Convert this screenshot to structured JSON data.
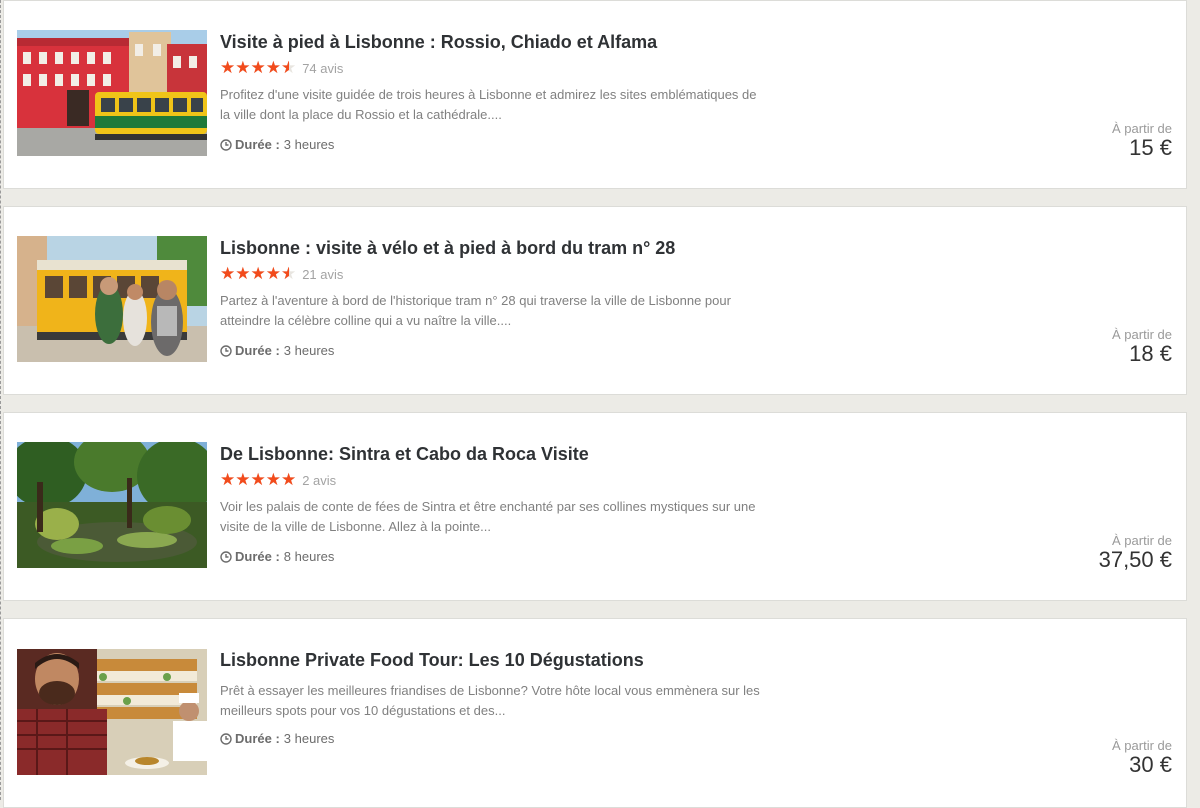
{
  "colors": {
    "star": "#f24b1c",
    "title": "#2f3235",
    "page_background": "#ecebe6"
  },
  "tours": [
    {
      "title": "Visite à pied à Lisbonne : Rossio, Chiado et Alfama",
      "rating": 4.5,
      "reviews": "74 avis",
      "description": "Profitez d'une visite guidée de trois heures à Lisbonne et admirez les sites emblématiques de la ville dont la place du Rossio et la cathédrale....",
      "duration_label": "Durée :",
      "duration_value": "3 heures",
      "price_from": "À partir de",
      "price": "15 €",
      "image": "lisbon-square-tram-photo"
    },
    {
      "title": "Lisbonne : visite à vélo et à pied à bord du tram n° 28",
      "rating": 4.5,
      "reviews": "21 avis",
      "description": "Partez à l'aventure à bord de l'historique tram n° 28 qui traverse la ville de Lisbonne pour atteindre la célèbre colline qui a vu naître la ville....",
      "duration_label": "Durée :",
      "duration_value": "3 heures",
      "price_from": "À partir de",
      "price": "18 €",
      "image": "tram-28-boarding-photo"
    },
    {
      "title": "De Lisbonne: Sintra et Cabo da Roca Visite",
      "rating": 5,
      "reviews": "2 avis",
      "description": "Voir les palais de conte de fées de Sintra et être enchanté par ses collines mystiques sur une visite de la ville de Lisbonne. Allez à la pointe...",
      "duration_label": "Durée :",
      "duration_value": "8 heures",
      "price_from": "À partir de",
      "price": "37,50 €",
      "image": "sintra-forest-pond-photo"
    },
    {
      "title": "Lisbonne Private Food Tour: Les 10 Dégustations",
      "description": "Prêt à essayer les meilleures friandises de Lisbonne? Votre hôte local vous emmènera sur les meilleurs spots pour vos 10 dégustations et des...",
      "duration_label": "Durée :",
      "duration_value": "3 heures",
      "price_from": "À partir de",
      "price": "30 €",
      "image": "food-tour-pastry-shop-photo"
    }
  ]
}
